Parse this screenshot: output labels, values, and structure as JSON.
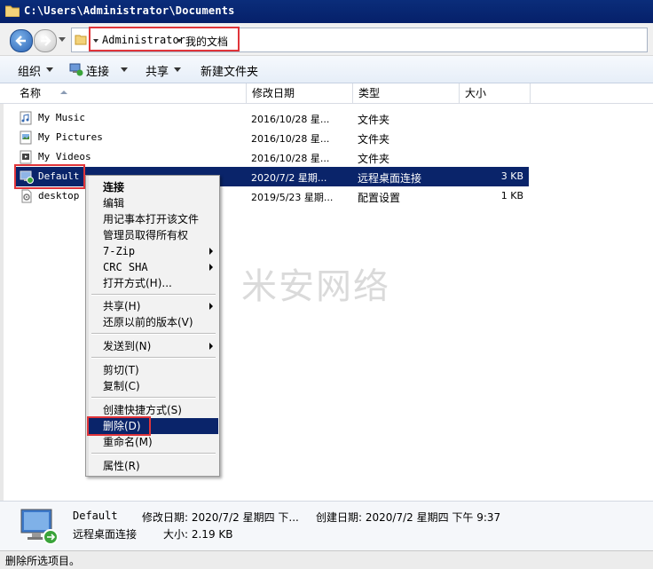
{
  "window": {
    "title": "C:\\Users\\Administrator\\Documents"
  },
  "address": {
    "crumbs": [
      "Administrator",
      "我的文档"
    ]
  },
  "toolbar": {
    "organize": "组织",
    "connect": "连接",
    "share": "共享",
    "new_folder": "新建文件夹"
  },
  "columns": {
    "name": "名称",
    "date": "修改日期",
    "type": "类型",
    "size": "大小"
  },
  "files": [
    {
      "name": "My Music",
      "date": "2016/10/28 星...",
      "type": "文件夹",
      "size": "",
      "icon": "music-folder-icon"
    },
    {
      "name": "My Pictures",
      "date": "2016/10/28 星...",
      "type": "文件夹",
      "size": "",
      "icon": "pictures-folder-icon"
    },
    {
      "name": "My Videos",
      "date": "2016/10/28 星...",
      "type": "文件夹",
      "size": "",
      "icon": "videos-folder-icon"
    },
    {
      "name": "Default",
      "date": "2020/7/2 星期...",
      "type": "远程桌面连接",
      "size": "3 KB",
      "icon": "rdp-file-icon",
      "selected": true
    },
    {
      "name": "desktop",
      "date": "2019/5/23 星期...",
      "type": "配置设置",
      "size": "1 KB",
      "icon": "config-file-icon"
    }
  ],
  "watermark": "米安网络",
  "context_menu": [
    {
      "label": "连接",
      "bold": true
    },
    {
      "label": "编辑"
    },
    {
      "label": "用记事本打开该文件"
    },
    {
      "label": "管理员取得所有权"
    },
    {
      "label": "7-Zip",
      "submenu": true
    },
    {
      "label": "CRC SHA",
      "submenu": true
    },
    {
      "label": "打开方式(H)..."
    },
    {
      "label": "共享(H)",
      "submenu": true
    },
    {
      "label": "还原以前的版本(V)"
    },
    {
      "label": "发送到(N)",
      "submenu": true
    },
    {
      "label": "剪切(T)"
    },
    {
      "label": "复制(C)"
    },
    {
      "label": "创建快捷方式(S)"
    },
    {
      "label": "删除(D)",
      "highlighted": true
    },
    {
      "label": "重命名(M)"
    },
    {
      "label": "属性(R)"
    }
  ],
  "details": {
    "name": "Default",
    "type": "远程桌面连接",
    "modified": "修改日期: 2020/7/2 星期四 下...",
    "created": "创建日期: 2020/7/2 星期四 下午 9:37",
    "size": "大小: 2.19 KB"
  },
  "status": {
    "text": "删除所选项目。"
  },
  "colors": {
    "title_bar": "#0a2d7a",
    "selection": "#0a246a",
    "annotation": "#e0353a"
  }
}
